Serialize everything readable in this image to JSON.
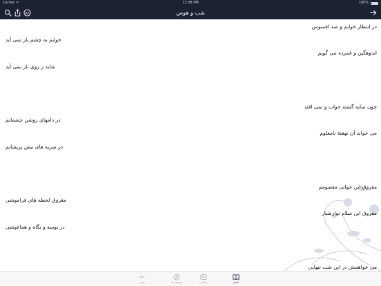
{
  "status_bar": {
    "carrier": "Carrier ᯤ",
    "time": "11:38 PM",
    "battery": "100%"
  },
  "nav": {
    "title": "شب و هوس",
    "icons": [
      "forward-arrow-icon",
      "search-icon",
      "share-icon",
      "font-size-icon"
    ]
  },
  "poem": {
    "verses": [
      "در انتظار خوابم و صد افسوس",
      "خوابم به چشم باز نمی آید",
      "اندوهگین و غمزده می گویم",
      "شاید ز روی ناز نمی آید",
      "چون سایه گشته خواب و نمی افتد",
      "در دامهای روشن چشمانم",
      "می خواند آن نهفتهٔ نامعلوم",
      "در ضربه های نبض پریشانم",
      "مغروق این جوانی معصومم",
      "مغروق لحظه های فراموشی",
      "مغروق این سلام نوازشبار",
      "در بوسه و نگاه و هماغوشی",
      "می خواهمش در این شب تنهایی"
    ]
  },
  "tabs": [
    {
      "label": "اشعار",
      "icon": "book-icon",
      "active": true
    },
    {
      "label": "زندگینامه",
      "icon": "user-card-icon",
      "active": false
    },
    {
      "label": "موسیقی ها",
      "icon": "music-icon",
      "active": false
    },
    {
      "label": "بیشتر",
      "icon": "more-icon",
      "active": false
    }
  ],
  "colors": {
    "header_bg": "#1d2233",
    "text": "#111111",
    "tab_inactive": "#9a9aa0",
    "tab_active": "#1d2233"
  }
}
